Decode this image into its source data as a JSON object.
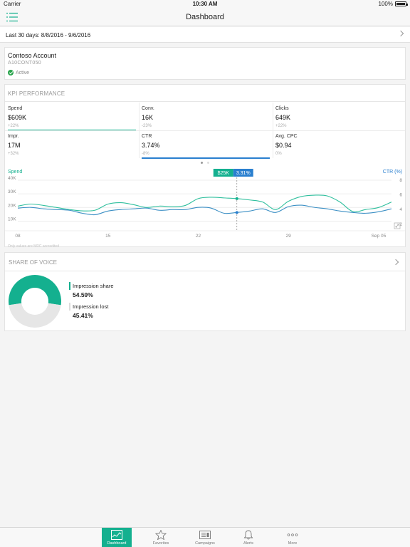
{
  "status_bar": {
    "carrier": "Carrier",
    "time": "10:30 AM",
    "battery": "100%"
  },
  "nav": {
    "title": "Dashboard"
  },
  "date_range": {
    "label": "Last 30 days: 8/8/2016 - 9/6/2016"
  },
  "account": {
    "name": "Contoso Account",
    "id": "A10CONT050",
    "status": "Active"
  },
  "kpi": {
    "title": "KPI PERFORMANCE",
    "metrics": [
      {
        "label": "Spend",
        "value": "$609K",
        "change": "+22%"
      },
      {
        "label": "Conv.",
        "value": "16K",
        "change": "-23%"
      },
      {
        "label": "Clicks",
        "value": "649K",
        "change": "+22%"
      },
      {
        "label": "Impr.",
        "value": "17M",
        "change": "+32%"
      },
      {
        "label": "CTR",
        "value": "3.74%",
        "change": "-8%"
      },
      {
        "label": "Avg. CPC",
        "value": "$0.94",
        "change": "0%"
      }
    ],
    "pager": {
      "pages": 2,
      "current": 1
    }
  },
  "chart_data": {
    "type": "line",
    "left_axis_label": "Spend",
    "right_axis_label": "CTR (%)",
    "left_ticks": [
      "10K",
      "20K",
      "30K",
      "40K"
    ],
    "right_ticks": [
      "2",
      "4",
      "6",
      "8"
    ],
    "x_ticks": [
      "08",
      "15",
      "22",
      "29",
      "Sep 05"
    ],
    "ylim_left": [
      5000,
      40000
    ],
    "ylim_right": [
      1.5,
      8
    ],
    "x_days": [
      0,
      1,
      2,
      3,
      4,
      5,
      6,
      7,
      8,
      9,
      10,
      11,
      12,
      13,
      14,
      15,
      16,
      17,
      18,
      19,
      20,
      21,
      22,
      23,
      24,
      25,
      26,
      27,
      28,
      29
    ],
    "series": [
      {
        "name": "Spend",
        "axis": "left",
        "color": "#2fbf9d",
        "values": [
          21000,
          22500,
          21500,
          20000,
          18500,
          17500,
          18000,
          22500,
          23500,
          22000,
          20000,
          21000,
          20500,
          21500,
          26500,
          27500,
          27000,
          26500,
          25500,
          24000,
          18500,
          24500,
          28000,
          29000,
          28500,
          24000,
          17000,
          18500,
          20000,
          24000
        ]
      },
      {
        "name": "CTR (%)",
        "axis": "right",
        "color": "#3b8fc4",
        "values": [
          4.2,
          4.3,
          4.1,
          4.0,
          3.9,
          3.5,
          3.3,
          3.8,
          4.0,
          4.1,
          4.2,
          3.9,
          4.0,
          4.0,
          4.3,
          4.2,
          3.5,
          3.6,
          3.8,
          4.1,
          3.6,
          4.4,
          4.6,
          4.3,
          4.1,
          3.8,
          3.6,
          3.5,
          3.7,
          4.1
        ]
      }
    ],
    "tooltip": {
      "spend": "$25K",
      "ctr": "3.31%"
    },
    "note": "Only values are MRC accredited"
  },
  "share_of_voice": {
    "title": "SHARE OF VOICE",
    "items": [
      {
        "label": "Impression share",
        "pct": "54.59%",
        "value": 54.59,
        "color": "#14b08f"
      },
      {
        "label": "Impression lost",
        "pct": "45.41%",
        "value": 45.41,
        "color": "#e6e6e6"
      }
    ]
  },
  "tabs": [
    {
      "label": "Dashboard",
      "icon": "dashboard-chart-icon",
      "active": true
    },
    {
      "label": "Favorites",
      "icon": "star-icon",
      "active": false
    },
    {
      "label": "Campaigns",
      "icon": "campaigns-icon",
      "active": false
    },
    {
      "label": "Alerts",
      "icon": "bell-icon",
      "active": false
    },
    {
      "label": "More",
      "icon": "more-dots-icon",
      "active": false
    }
  ],
  "colors": {
    "accent": "#14b08f",
    "blue": "#2a7fcf"
  }
}
